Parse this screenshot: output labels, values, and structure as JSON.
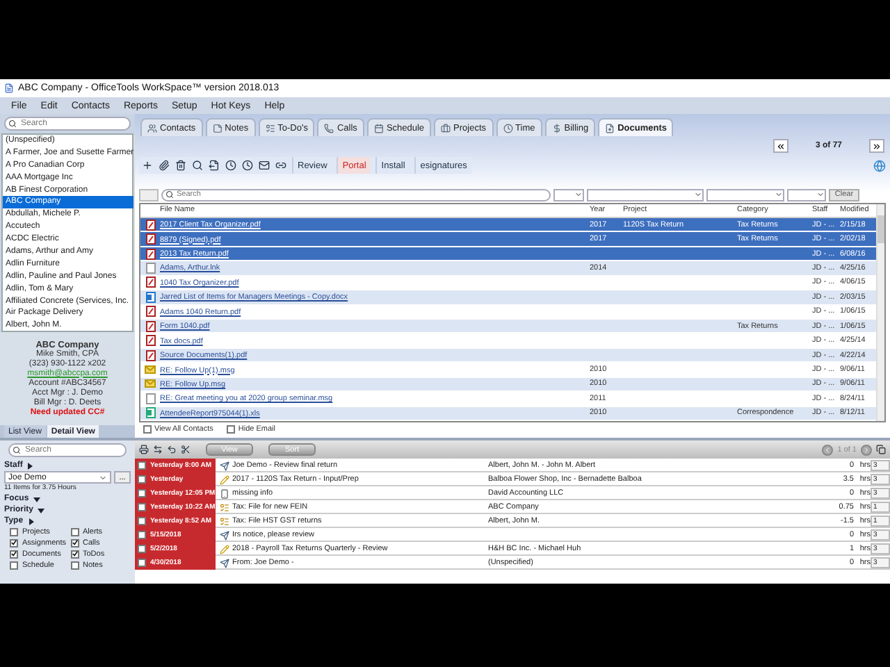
{
  "window": {
    "title": "ABC Company - OfficeTools WorkSpace™ version 2018.013"
  },
  "menu": [
    "File",
    "Edit",
    "Contacts",
    "Reports",
    "Setup",
    "Hot Keys",
    "Help"
  ],
  "sidebar": {
    "search_placeholder": "Search",
    "contacts": [
      {
        "name": "(Unspecified)",
        "selected": false
      },
      {
        "name": "A Farmer, Joe and Susette Farmer",
        "selected": false
      },
      {
        "name": "A Pro Canadian Corp",
        "selected": false
      },
      {
        "name": "AAA Mortgage Inc",
        "selected": false
      },
      {
        "name": "AB Finest Corporation",
        "selected": false
      },
      {
        "name": "ABC Company",
        "selected": true
      },
      {
        "name": "Abdullah, Michele P.",
        "selected": false
      },
      {
        "name": "Accutech",
        "selected": false
      },
      {
        "name": "ACDC Electric",
        "selected": false
      },
      {
        "name": "Adams, Arthur and Amy",
        "selected": false
      },
      {
        "name": "Adlin Furniture",
        "selected": false
      },
      {
        "name": "Adlin, Pauline and Paul Jones",
        "selected": false
      },
      {
        "name": "Adlin, Tom & Mary",
        "selected": false
      },
      {
        "name": "Affiliated Concrete (Services, Inc.",
        "selected": false
      },
      {
        "name": "Air Package Delivery",
        "selected": false
      },
      {
        "name": "Albert, John M.",
        "selected": false
      }
    ],
    "card": [
      {
        "kind": "title",
        "text": "ABC Company"
      },
      {
        "kind": "text",
        "text": "Mike Smith, CPA"
      },
      {
        "kind": "text",
        "text": "(323) 930-1122 x202"
      },
      {
        "kind": "link",
        "text": "msmith@abccpa.com"
      },
      {
        "kind": "text",
        "text": "Account #ABC34567"
      },
      {
        "kind": "text",
        "text": "Acct Mgr : J. Demo"
      },
      {
        "kind": "text",
        "text": "Bill Mgr : D. Deets"
      },
      {
        "kind": "alert",
        "text": "Need updated CC#"
      }
    ],
    "views": [
      {
        "label": "List View",
        "selected": false
      },
      {
        "label": "Detail View",
        "selected": true
      }
    ]
  },
  "tabs": [
    {
      "label": "Contacts",
      "selected": false
    },
    {
      "label": "Notes",
      "selected": false
    },
    {
      "label": "To-Do's",
      "selected": false
    },
    {
      "label": "Calls",
      "selected": false
    },
    {
      "label": "Schedule",
      "selected": false
    },
    {
      "label": "Projects",
      "selected": false
    },
    {
      "label": "Time",
      "selected": false
    },
    {
      "label": "Billing",
      "selected": false
    },
    {
      "label": "Documents",
      "selected": true
    }
  ],
  "pager": "3 of 77",
  "actions": [
    {
      "label": "Review",
      "kind": "plain"
    },
    {
      "label": "Portal",
      "kind": "alert"
    },
    {
      "label": "Install",
      "kind": "plain"
    },
    {
      "label": "esignatures",
      "kind": "plain"
    }
  ],
  "filter": {
    "placeholder": "Search",
    "button": "Clear"
  },
  "documents": {
    "columns": [
      "File Name",
      "Year",
      "Project",
      "Category",
      "Staff",
      "Modified"
    ],
    "rows": [
      {
        "kind": "pdf",
        "name": "2017 Client Tax Organizer.pdf",
        "year": "2017",
        "project": "1120S Tax Return",
        "category": "Tax Returns",
        "staff": "JD - ...",
        "modified": "2/15/18",
        "selected": true
      },
      {
        "kind": "pdf",
        "name": "8879 (Signed).pdf",
        "year": "2017",
        "project": "",
        "category": "Tax Returns",
        "staff": "JD - ...",
        "modified": "2/02/18",
        "selected": true
      },
      {
        "kind": "pdf",
        "name": "2013 Tax Return.pdf",
        "year": "",
        "project": "",
        "category": "",
        "staff": "JD - ...",
        "modified": "6/08/16",
        "selected": true
      },
      {
        "kind": "file",
        "name": "Adams, Arthur.lnk",
        "year": "2014",
        "project": "",
        "category": "",
        "staff": "JD - ...",
        "modified": "4/25/16",
        "selected": false
      },
      {
        "kind": "pdf",
        "name": "1040 Tax Organizer.pdf",
        "year": "",
        "project": "",
        "category": "",
        "staff": "JD - ...",
        "modified": "4/06/15",
        "selected": false
      },
      {
        "kind": "doc",
        "name": "Jarred List of Items for Managers Meetings - Copy.docx",
        "year": "",
        "project": "",
        "category": "",
        "staff": "JD - ...",
        "modified": "2/03/15",
        "selected": false
      },
      {
        "kind": "pdf",
        "name": "Adams 1040 Return.pdf",
        "year": "",
        "project": "",
        "category": "",
        "staff": "JD - ...",
        "modified": "1/06/15",
        "selected": false
      },
      {
        "kind": "pdf",
        "name": "Form 1040.pdf",
        "year": "",
        "project": "",
        "category": "Tax Returns",
        "staff": "JD - ...",
        "modified": "1/06/15",
        "selected": false
      },
      {
        "kind": "pdf",
        "name": "Tax docs.pdf",
        "year": "",
        "project": "",
        "category": "",
        "staff": "JD - ...",
        "modified": "4/25/14",
        "selected": false
      },
      {
        "kind": "pdf",
        "name": "Source Documents(1).pdf",
        "year": "",
        "project": "",
        "category": "",
        "staff": "JD - ...",
        "modified": "4/22/14",
        "selected": false
      },
      {
        "kind": "msg",
        "name": "RE: Follow Up(1).msg",
        "year": "2010",
        "project": "",
        "category": "",
        "staff": "JD - ...",
        "modified": "9/06/11",
        "selected": false
      },
      {
        "kind": "msg",
        "name": "RE: Follow Up.msg",
        "year": "2010",
        "project": "",
        "category": "",
        "staff": "JD - ...",
        "modified": "9/06/11",
        "selected": false
      },
      {
        "kind": "file",
        "name": "RE: Great meeting you at 2020 group seminar.msg",
        "year": "2011",
        "project": "",
        "category": "",
        "staff": "JD - ...",
        "modified": "8/24/11",
        "selected": false
      },
      {
        "kind": "xls",
        "name": "AttendeeReport975044(1).xls",
        "year": "2010",
        "project": "",
        "category": "Correspondence",
        "staff": "JD - ...",
        "modified": "8/12/11",
        "selected": false
      }
    ]
  },
  "options": [
    {
      "label": "View All Contacts",
      "checked": false
    },
    {
      "label": "Hide Email",
      "checked": false
    }
  ],
  "task_filter": {
    "search_placeholder": "Search",
    "staff_label": "Staff",
    "staff_expanded": false,
    "staff_value": "Joe Demo",
    "more": "...",
    "summary": "11 Items for 3.75 Hours",
    "sections": [
      {
        "label": "Focus",
        "expanded": true
      },
      {
        "label": "Priority",
        "expanded": true
      },
      {
        "label": "Type",
        "expanded": false
      }
    ],
    "types": [
      {
        "label": "Projects",
        "checked": false
      },
      {
        "label": "Alerts",
        "checked": false
      },
      {
        "label": "Assignments",
        "checked": true
      },
      {
        "label": "Calls",
        "checked": true
      },
      {
        "label": "Documents",
        "checked": true
      },
      {
        "label": "ToDos",
        "checked": true
      },
      {
        "label": "Schedule",
        "checked": false
      },
      {
        "label": "Notes",
        "checked": false
      }
    ]
  },
  "task_toolbar": {
    "buttons": [
      "View",
      "Sort"
    ],
    "pager": "1 of 1"
  },
  "tasks": [
    {
      "when": "Yesterday 8:00 AM",
      "kind": "assignment",
      "subject": "Joe Demo - Review final return",
      "contact": "Albert, John M. - John M. Albert",
      "hours": "0",
      "unit": "hrs",
      "priority": "3",
      "checked": false
    },
    {
      "when": "Yesterday",
      "kind": "project",
      "subject": "2017 - 1120S Tax Return - Input/Prep",
      "contact": "Balboa Flower Shop, Inc - Bernadette Balboa",
      "hours": "3.5",
      "unit": "hrs",
      "priority": "3",
      "checked": false
    },
    {
      "when": "Yesterday 12:05 PM",
      "kind": "call",
      "subject": "missing info",
      "contact": "David Accounting LLC",
      "hours": "0",
      "unit": "hrs",
      "priority": "3",
      "checked": false
    },
    {
      "when": "Yesterday 10:22 AM",
      "kind": "todo",
      "subject": "Tax: File for new FEIN",
      "contact": "ABC Company",
      "hours": "0.75",
      "unit": "hrs",
      "priority": "1",
      "checked": false
    },
    {
      "when": "Yesterday 8:52 AM",
      "kind": "todo",
      "subject": "Tax: File HST GST returns",
      "contact": "Albert, John M.",
      "hours": "-1.5",
      "unit": "hrs",
      "priority": "1",
      "checked": false
    },
    {
      "when": "5/15/2018",
      "kind": "assignment",
      "subject": "Irs notice, please review",
      "hours": "0",
      "unit": "hrs",
      "priority": "3",
      "checked": false
    },
    {
      "when": "5/2/2018",
      "kind": "project",
      "subject": "2018 - Payroll Tax Returns Quarterly - Review",
      "contact": "H&H BC Inc. - Michael Huh",
      "hours": "1",
      "unit": "hrs",
      "priority": "3",
      "checked": false
    },
    {
      "when": "4/30/2018",
      "kind": "assignment",
      "subject": "From: Joe Demo -",
      "contact": "(Unspecified)",
      "hours": "0",
      "unit": "hrs",
      "priority": "3",
      "checked": false
    }
  ]
}
